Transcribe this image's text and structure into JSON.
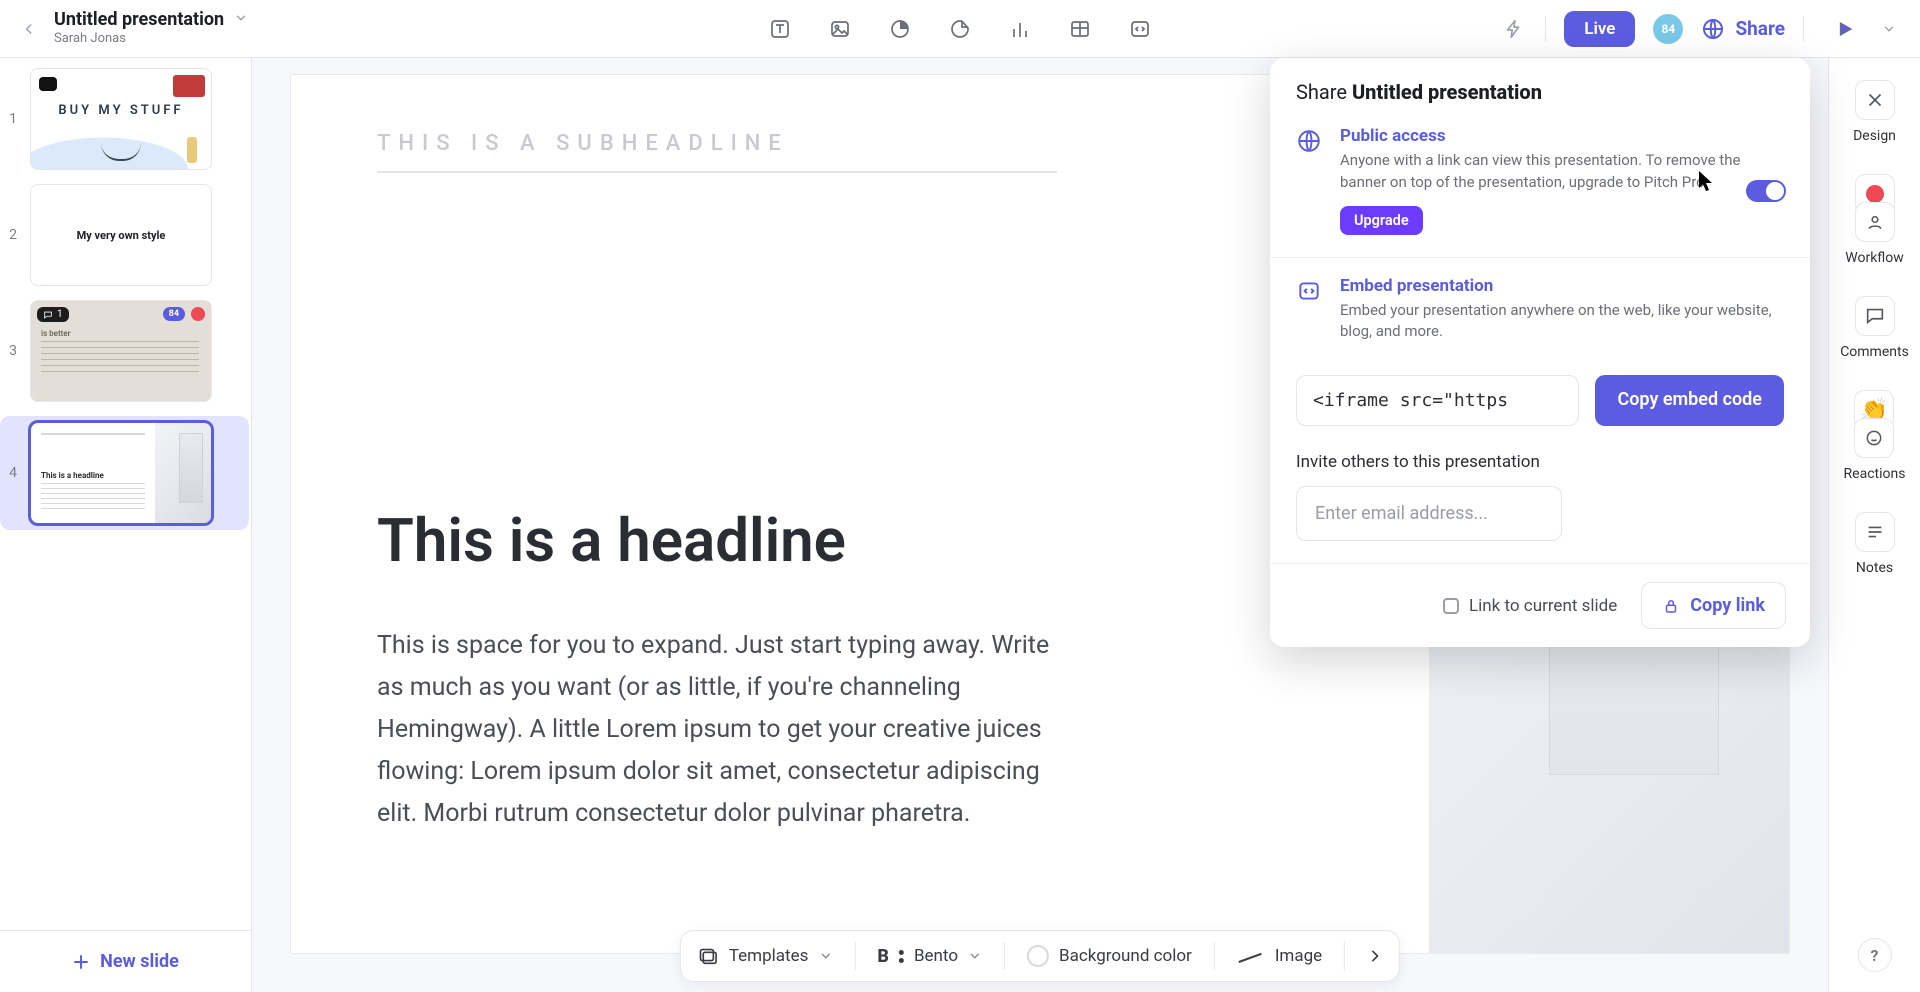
{
  "header": {
    "title": "Untitled presentation",
    "owner": "Sarah Jonas",
    "live_label": "Live",
    "share_label": "Share",
    "avatar_label": "84"
  },
  "thumbs": {
    "t1_text": "BUY MY STUFF",
    "t2_text": "My very own style",
    "t3_comment_count": "1",
    "t3_pill": "84",
    "t3_head": "is better",
    "t4_head": "This is a headline"
  },
  "new_slide_label": "New slide",
  "slide": {
    "subhead": "THIS IS A SUBHEADLINE",
    "headline": "This is a headline",
    "body": "This is space for you to expand. Just start typing away. Write as much as you want (or as little, if you're channeling Hemingway). A little Lorem ipsum to get your creative juices flowing: Lorem ipsum dolor sit amet, consectetur adipiscing elit. Morbi rutrum consectetur dolor pulvinar pharetra."
  },
  "share_panel": {
    "title_prefix": "Share ",
    "title_name": "Untitled presentation",
    "public": {
      "title": "Public access",
      "desc": "Anyone with a link can view this presentation. To remove the banner on top of the presentation, upgrade to Pitch Pro.",
      "upgrade": "Upgrade"
    },
    "embed": {
      "title": "Embed presentation",
      "desc": "Embed your presentation anywhere on the web, like your website, blog, and more.",
      "code": "<iframe src=\"https",
      "copy": "Copy embed code"
    },
    "invite_label": "Invite others to this presentation",
    "invite_placeholder": "Enter email address...",
    "link_current": "Link to current slide",
    "copy_link": "Copy link"
  },
  "rail": {
    "design": "Design",
    "workflow": "Workflow",
    "comments": "Comments",
    "reactions": "Reactions",
    "notes": "Notes"
  },
  "bottom": {
    "templates": "Templates",
    "bento": "Bento",
    "bg": "Background color",
    "image": "Image"
  }
}
